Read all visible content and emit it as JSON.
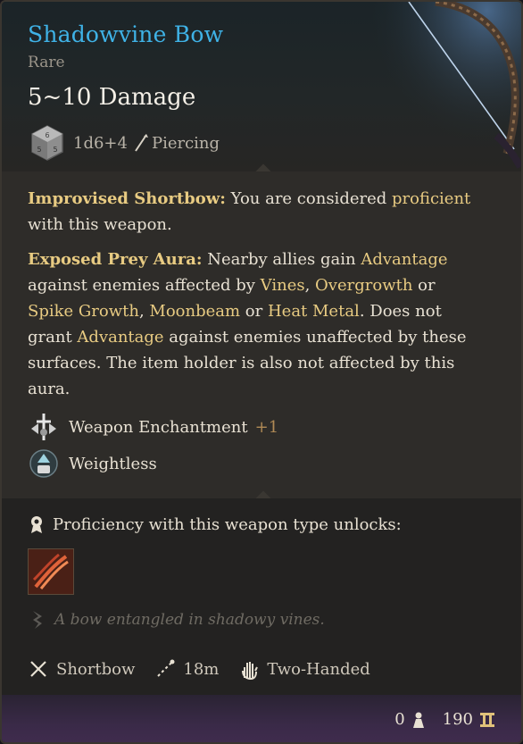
{
  "item": {
    "name": "Shadowvine Bow",
    "rarity": "Rare",
    "damage": "5~10 Damage",
    "dice": "1d6+4",
    "damage_type": "Piercing"
  },
  "passives": {
    "p1": {
      "lead": "Improvised Shortbow:",
      "t1": " You are considered ",
      "k1": "proficient",
      "t2": " with this weapon."
    },
    "p2": {
      "lead": "Exposed Prey Aura:",
      "t1": " Nearby allies gain ",
      "k1": "Advantage",
      "t2": " against enemies affected by ",
      "k2": "Vines",
      "t3": ", ",
      "k3": "Overgrowth",
      "t4": " or ",
      "k4": "Spike Growth",
      "t5": ", ",
      "k5": "Moonbeam",
      "t6": " or ",
      "k6": "Heat Metal",
      "t7": ". Does not grant ",
      "k7": "Advantage",
      "t8": " against enemies unaffected by these surfaces. The item holder is also not affected by this aura."
    }
  },
  "properties": {
    "enchantment_label": "Weapon Enchantment",
    "enchantment_bonus": "+1",
    "weightless_label": "Weightless"
  },
  "proficiency": {
    "label": "Proficiency with this weapon type unlocks:"
  },
  "flavor": "A bow entangled in shadowy vines.",
  "tags": {
    "type": "Shortbow",
    "range": "18m",
    "handedness": "Two-Handed"
  },
  "stats": {
    "weight": "0",
    "value": "190"
  },
  "colors": {
    "title": "#3fb2e6",
    "keyword": "#e8cb82",
    "bonus": "#b08a55"
  }
}
